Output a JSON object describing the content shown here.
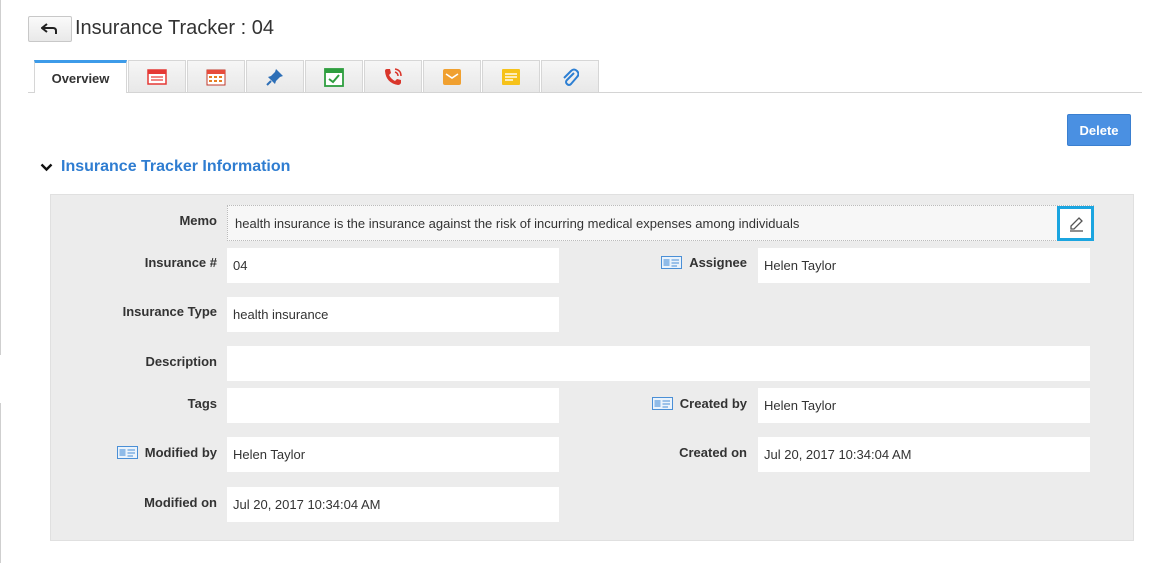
{
  "header": {
    "title": "Insurance Tracker : 04"
  },
  "tabs": [
    {
      "label": "Overview",
      "icon": ""
    },
    {
      "label": "",
      "icon": "list-icon"
    },
    {
      "label": "",
      "icon": "calendar-icon"
    },
    {
      "label": "",
      "icon": "pin-icon"
    },
    {
      "label": "",
      "icon": "task-icon"
    },
    {
      "label": "",
      "icon": "phone-icon"
    },
    {
      "label": "",
      "icon": "mail-icon"
    },
    {
      "label": "",
      "icon": "note-icon"
    },
    {
      "label": "",
      "icon": "attachment-icon"
    }
  ],
  "actions": {
    "delete_label": "Delete"
  },
  "section": {
    "title": "Insurance Tracker Information"
  },
  "fields": {
    "memo": {
      "label": "Memo",
      "value": "health insurance is the insurance against the risk of incurring medical expenses among individuals"
    },
    "insurance_no": {
      "label": "Insurance #",
      "value": "04"
    },
    "assignee": {
      "label": "Assignee",
      "value": "Helen Taylor"
    },
    "insurance_type": {
      "label": "Insurance Type",
      "value": "health insurance"
    },
    "description": {
      "label": "Description",
      "value": ""
    },
    "tags": {
      "label": "Tags",
      "value": ""
    },
    "created_by": {
      "label": "Created by",
      "value": "Helen Taylor"
    },
    "modified_by": {
      "label": "Modified by",
      "value": "Helen Taylor"
    },
    "created_on": {
      "label": "Created on",
      "value": "Jul 20, 2017 10:34:04 AM"
    },
    "modified_on": {
      "label": "Modified on",
      "value": "Jul 20, 2017 10:34:04 AM"
    }
  },
  "colors": {
    "accent": "#4a90e2",
    "section_title": "#2f7dd1",
    "tab_active": "#3d9be9",
    "edit_highlight": "#1ba5e0"
  }
}
